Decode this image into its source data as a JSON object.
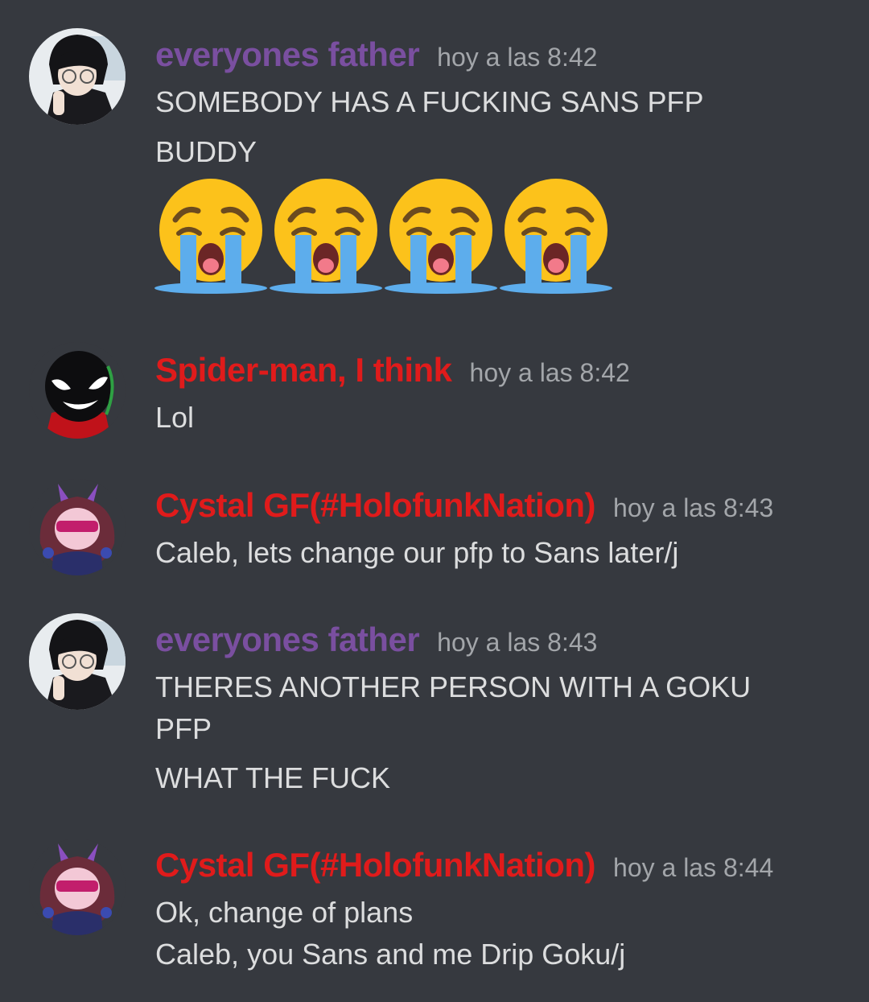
{
  "colors": {
    "background": "#36393f",
    "username_purple": "#7a4fa0",
    "username_red": "#e01b1b",
    "timestamp": "#a3a6aa",
    "text": "#dcddde"
  },
  "messages": [
    {
      "username": "everyones father",
      "timestamp": "hoy a las 8:42",
      "avatar_icon": "anime-boy-glasses-avatar",
      "lines": [
        "SOMEBODY HAS A FUCKING SANS PFP",
        "BUDDY"
      ],
      "emojis": [
        "loudly-crying-face-icon",
        "loudly-crying-face-icon",
        "loudly-crying-face-icon",
        "loudly-crying-face-icon"
      ]
    },
    {
      "username": "Spider-man, I think",
      "timestamp": "hoy a las 8:42",
      "avatar_icon": "venom-face-avatar",
      "lines": [
        "Lol"
      ]
    },
    {
      "username": "Cystal GF(#HolofunkNation)",
      "timestamp": "hoy a las 8:43",
      "avatar_icon": "horned-girl-avatar",
      "lines": [
        "Caleb, lets change our pfp to Sans later/j"
      ]
    },
    {
      "username": "everyones father",
      "timestamp": "hoy a las 8:43",
      "avatar_icon": "anime-boy-glasses-avatar",
      "lines": [
        "THERES ANOTHER PERSON WITH A GOKU",
        "PFP",
        "WHAT THE FUCK"
      ]
    },
    {
      "username": "Cystal GF(#HolofunkNation)",
      "timestamp": "hoy a las 8:44",
      "avatar_icon": "horned-girl-avatar",
      "lines": [
        "Ok, change of plans",
        "Caleb, you Sans and me Drip Goku/j"
      ]
    }
  ]
}
